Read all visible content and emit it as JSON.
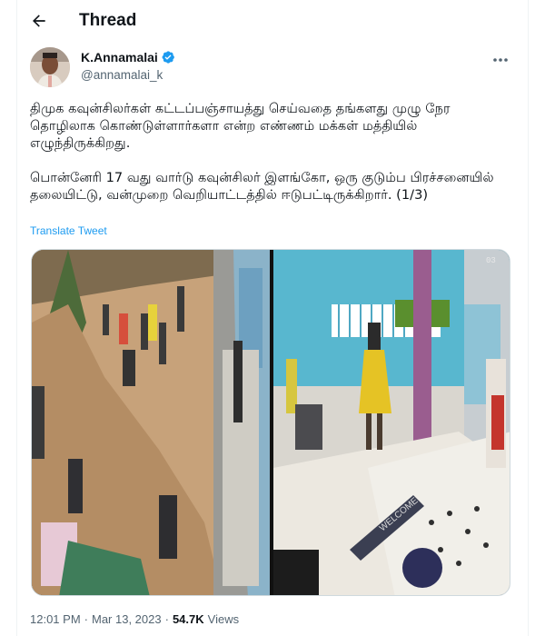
{
  "header": {
    "title": "Thread",
    "back_icon": "arrow-left-icon"
  },
  "author": {
    "name": "K.Annamalai",
    "handle": "@annamalai_k",
    "verified_color": "#1d9bf0"
  },
  "tweet": {
    "paragraph1": "திமுக கவுன்சிலர்கள் கட்டப்பஞ்சாயத்து செய்வதை தங்களது முழு நேர தொழிலாக கொண்டுள்ளார்களா என்ற எண்ணம் மக்கள் மத்தியில் எழுந்திருக்கிறது.",
    "paragraph2": "பொன்னேரி 17 வது வார்டு கவுன்சிலர் இளங்கோ, ஒரு குடும்ப பிரச்சனையில் தலையிட்டு, வன்முறை வெறியாட்டத்தில் ஈடுபட்டிருக்கிறார். (1/3)",
    "translate_label": "Translate Tweet"
  },
  "media": {
    "right_stamp": "03",
    "mat_text": "WELCOME"
  },
  "meta": {
    "time": "12:01 PM",
    "separator": "·",
    "date": "Mar 13, 2023",
    "views_count": "54.7K",
    "views_label": "Views"
  },
  "colors": {
    "link": "#1d9bf0",
    "muted": "#536471",
    "text": "#0f1419"
  }
}
